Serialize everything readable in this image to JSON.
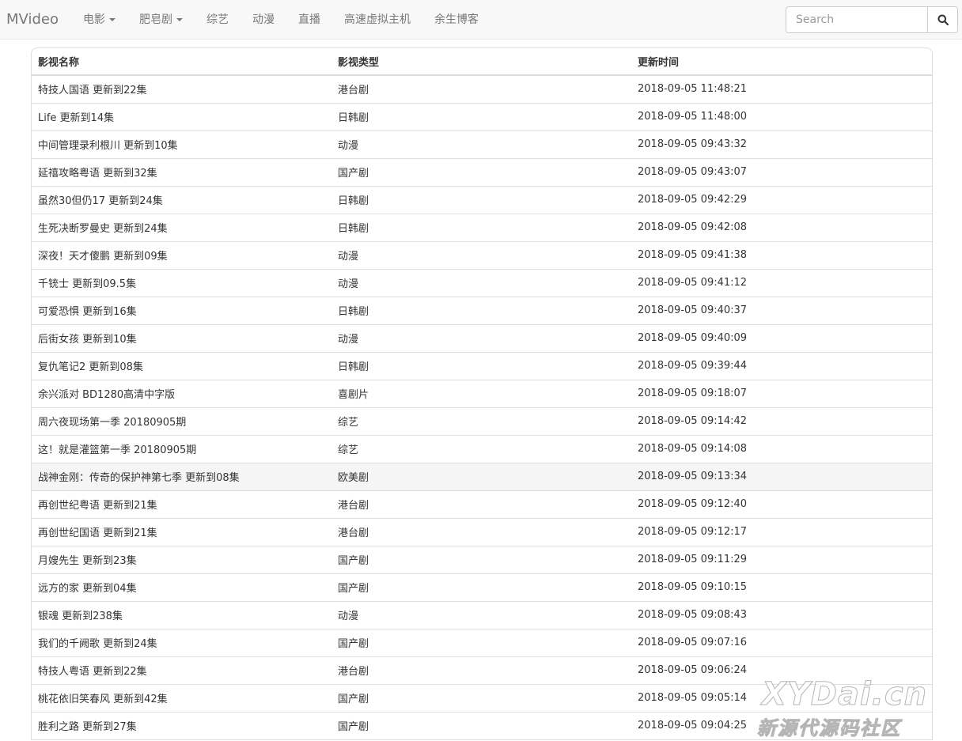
{
  "navbar": {
    "brand": "MVideo",
    "items": [
      {
        "label": "电影",
        "dropdown": true
      },
      {
        "label": "肥皂剧",
        "dropdown": true
      },
      {
        "label": "综艺",
        "dropdown": false
      },
      {
        "label": "动漫",
        "dropdown": false
      },
      {
        "label": "直播",
        "dropdown": false
      },
      {
        "label": "高速虚拟主机",
        "dropdown": false
      },
      {
        "label": "余生博客",
        "dropdown": false
      }
    ],
    "search": {
      "placeholder": "Search",
      "button_icon": "search-icon"
    }
  },
  "table": {
    "headers": [
      "影视名称",
      "影视类型",
      "更新时间"
    ],
    "highlight_row": 14,
    "rows": [
      [
        "特技人国语 更新到22集",
        "港台剧",
        "2018-09-05 11:48:21"
      ],
      [
        "Life 更新到14集",
        "日韩剧",
        "2018-09-05 11:48:00"
      ],
      [
        "中间管理录利根川 更新到10集",
        "动漫",
        "2018-09-05 09:43:32"
      ],
      [
        "延禧攻略粤语 更新到32集",
        "国产剧",
        "2018-09-05 09:43:07"
      ],
      [
        "虽然30但仍17 更新到24集",
        "日韩剧",
        "2018-09-05 09:42:29"
      ],
      [
        "生死决断罗曼史 更新到24集",
        "日韩剧",
        "2018-09-05 09:42:08"
      ],
      [
        "深夜！天才傻鹏 更新到09集",
        "动漫",
        "2018-09-05 09:41:38"
      ],
      [
        "千铳士 更新到09.5集",
        "动漫",
        "2018-09-05 09:41:12"
      ],
      [
        "可爱恐惧 更新到16集",
        "日韩剧",
        "2018-09-05 09:40:37"
      ],
      [
        "后街女孩 更新到10集",
        "动漫",
        "2018-09-05 09:40:09"
      ],
      [
        "复仇笔记2 更新到08集",
        "日韩剧",
        "2018-09-05 09:39:44"
      ],
      [
        "余兴派对 BD1280高清中字版",
        "喜剧片",
        "2018-09-05 09:18:07"
      ],
      [
        "周六夜现场第一季 20180905期",
        "综艺",
        "2018-09-05 09:14:42"
      ],
      [
        "这！就是灌篮第一季 20180905期",
        "综艺",
        "2018-09-05 09:14:08"
      ],
      [
        "战神金刚：传奇的保护神第七季 更新到08集",
        "欧美剧",
        "2018-09-05 09:13:34"
      ],
      [
        "再创世纪粤语 更新到21集",
        "港台剧",
        "2018-09-05 09:12:40"
      ],
      [
        "再创世纪国语 更新到21集",
        "港台剧",
        "2018-09-05 09:12:17"
      ],
      [
        "月嫂先生 更新到23集",
        "国产剧",
        "2018-09-05 09:11:29"
      ],
      [
        "远方的家 更新到04集",
        "国产剧",
        "2018-09-05 09:10:15"
      ],
      [
        "银魂 更新到238集",
        "动漫",
        "2018-09-05 09:08:43"
      ],
      [
        "我们的千阙歌 更新到24集",
        "国产剧",
        "2018-09-05 09:07:16"
      ],
      [
        "特技人粤语 更新到22集",
        "港台剧",
        "2018-09-05 09:06:24"
      ],
      [
        "桃花依旧笑春风 更新到42集",
        "国产剧",
        "2018-09-05 09:05:14"
      ],
      [
        "胜利之路 更新到27集",
        "国产剧",
        "2018-09-05 09:04:25"
      ]
    ]
  },
  "watermark": {
    "line1": "XYDai.cn",
    "line2": "新源代源码社区"
  },
  "colors": {
    "navbar_bg": "#f8f8f8",
    "nav_text": "#777777",
    "border": "#dddddd",
    "hover_row": "#f5f5f5"
  }
}
